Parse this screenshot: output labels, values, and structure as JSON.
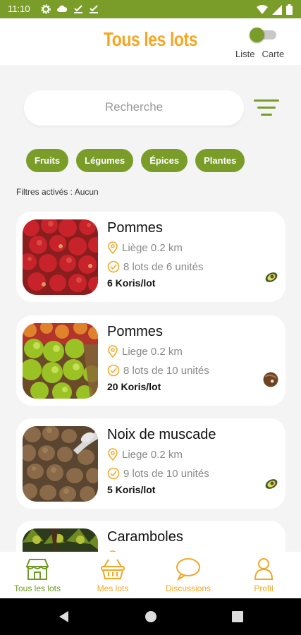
{
  "status_bar": {
    "time": "11:10"
  },
  "header": {
    "title": "Tous les lots",
    "toggle": {
      "left_label": "Liste",
      "right_label": "Carte",
      "state": "Liste"
    }
  },
  "search": {
    "placeholder": "Recherche"
  },
  "chips": [
    "Fruits",
    "Légumes",
    "Épices",
    "Plantes"
  ],
  "active_filters": "Filtres activés : Aucun",
  "lots": [
    {
      "name": "Pommes",
      "location": "Liège  0.2 km",
      "quantity": "8 lots de 6 unités",
      "price": "6 Koris/lot",
      "image": "red-apples",
      "flag": "avocado-icon"
    },
    {
      "name": "Pommes",
      "location": "Liege 0.2 km",
      "quantity": "8 lots de 10 unités",
      "price": "20 Koris/lot",
      "image": "green-apples",
      "flag": "coconut-icon"
    },
    {
      "name": "Noix de muscade",
      "location": "Liege 0.2 km",
      "quantity": "9 lots de 10 unités",
      "price": "5 Koris/lot",
      "image": "nutmeg",
      "flag": "avocado-icon"
    },
    {
      "name": "Caramboles",
      "location": "",
      "quantity": "",
      "price": "",
      "image": "carambola",
      "flag": ""
    }
  ],
  "bottom_nav": [
    {
      "label": "Tous les lots",
      "icon": "shop-icon",
      "active": true
    },
    {
      "label": "Mes lots",
      "icon": "basket-icon",
      "active": false
    },
    {
      "label": "Discussions",
      "icon": "chat-icon",
      "active": false
    },
    {
      "label": "Profil",
      "icon": "user-icon",
      "active": false
    }
  ],
  "colors": {
    "primary_green": "#7a9d2a",
    "accent_orange": "#f5a623",
    "background": "#f4f4f4"
  }
}
